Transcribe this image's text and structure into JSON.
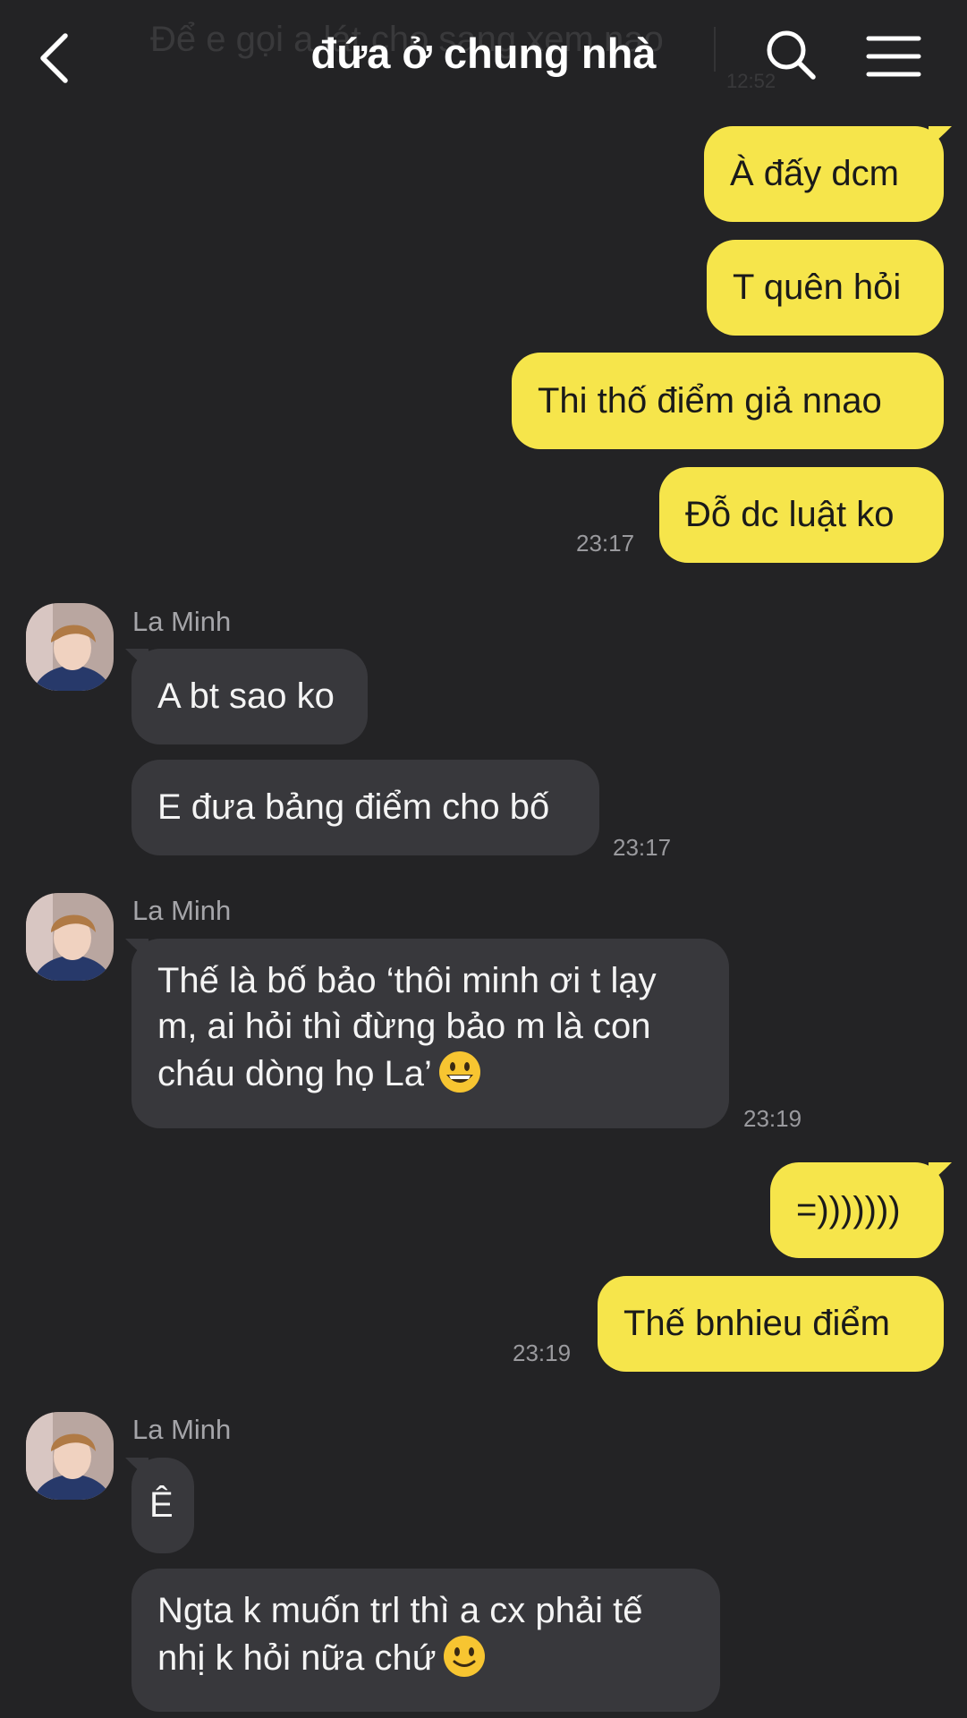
{
  "header": {
    "title": "đứa ở chung nhà",
    "ghost_preview": "Để e gọi a lát cho sang xem nao",
    "ghost_time": "12:52",
    "back_icon": "chevron-left-icon",
    "search_icon": "search-icon",
    "menu_icon": "hamburger-menu-icon"
  },
  "colors": {
    "background": "#232325",
    "outgoing": "#f6e54b",
    "incoming": "#38383c",
    "timestamp": "#9a9a9e"
  },
  "messages": {
    "m1": "À đấy dcm",
    "m2": "T quên hỏi",
    "m3": "Thi thố điểm giả nnao",
    "m4": "Đỗ dc luật ko",
    "t1": "23:17",
    "sender1": "La Minh",
    "m5": "A bt sao ko",
    "m6": "E đưa bảng điểm cho bố",
    "t2": "23:17",
    "sender2": "La Minh",
    "m7": "Thế là bố bảo ‘thôi minh ơi t lạy m, ai hỏi thì đừng bảo m là con cháu dòng họ La’",
    "t3": "23:19",
    "m8": "=)))))))",
    "m9": "Thế bnhieu điểm",
    "t4": "23:19",
    "sender3": "La Minh",
    "m10": "Ê",
    "m11": "Ngta k muốn trl thì a cx phải tế nhị k hỏi nữa chứ"
  }
}
